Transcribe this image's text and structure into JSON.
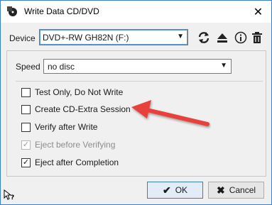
{
  "window": {
    "title": "Write Data CD/DVD"
  },
  "device": {
    "label": "Device",
    "selected": "DVD+-RW GH82N (F:)",
    "icons": [
      "refresh-icon",
      "eject-icon",
      "info-icon",
      "trash-icon"
    ]
  },
  "speed": {
    "label": "Speed",
    "selected": "no disc"
  },
  "options": [
    {
      "label": "Test Only, Do Not Write",
      "checked": false,
      "enabled": true
    },
    {
      "label": "Create CD-Extra Session",
      "checked": false,
      "enabled": true
    },
    {
      "label": "Verify after Write",
      "checked": false,
      "enabled": true
    },
    {
      "label": "Eject before Verifying",
      "checked": true,
      "enabled": false
    },
    {
      "label": "Eject after Completion",
      "checked": true,
      "enabled": true
    }
  ],
  "buttons": {
    "ok": "OK",
    "cancel": "Cancel"
  },
  "colors": {
    "annotation_arrow": "#e8403a",
    "window_border": "#3a7fc8"
  }
}
